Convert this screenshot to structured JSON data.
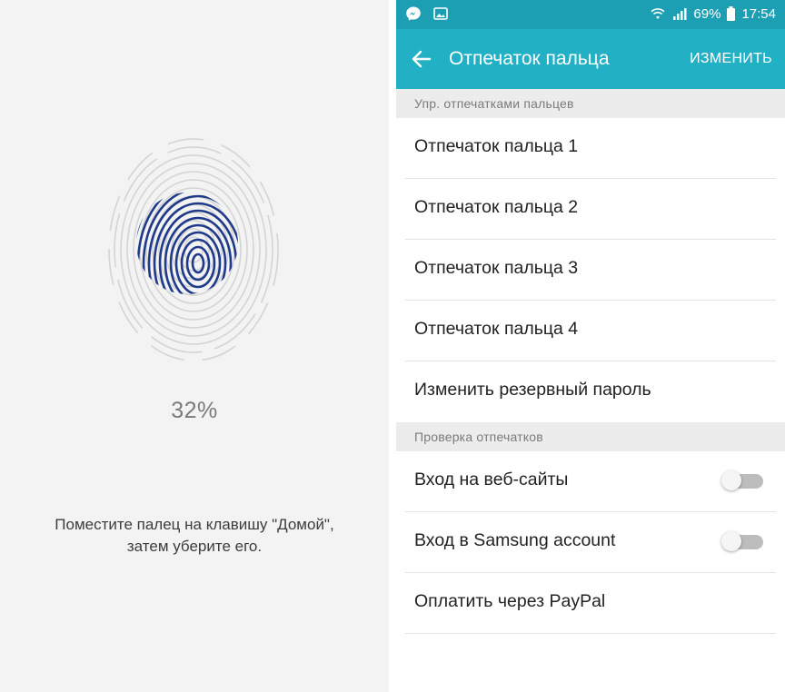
{
  "enroll": {
    "progress": "32%",
    "instruction": "Поместите палец на клавишу \"Домой\",\nзатем уберите его."
  },
  "statusbar": {
    "battery": "69%",
    "time": "17:54",
    "icons": [
      "messenger-icon",
      "gallery-icon",
      "wifi-icon",
      "signal-icon",
      "battery-icon"
    ]
  },
  "appbar": {
    "title": "Отпечаток пальца",
    "edit_label": "ИЗМЕНИТЬ"
  },
  "sections": [
    {
      "header": "Упр. отпечатками пальцев",
      "items": [
        {
          "label": "Отпечаток пальца 1"
        },
        {
          "label": "Отпечаток пальца 2"
        },
        {
          "label": "Отпечаток пальца 3"
        },
        {
          "label": "Отпечаток пальца 4"
        },
        {
          "label": "Изменить резервный пароль"
        }
      ]
    },
    {
      "header": "Проверка отпечатков",
      "items": [
        {
          "label": "Вход на веб-сайты",
          "toggle": false
        },
        {
          "label": "Вход в Samsung account",
          "toggle": false
        },
        {
          "label": "Оплатить через PayPal"
        }
      ]
    }
  ],
  "colors": {
    "statusbar": "#1d9fb3",
    "appbar": "#22b0c4",
    "fingerprint_fill": "#1f3a8a"
  }
}
